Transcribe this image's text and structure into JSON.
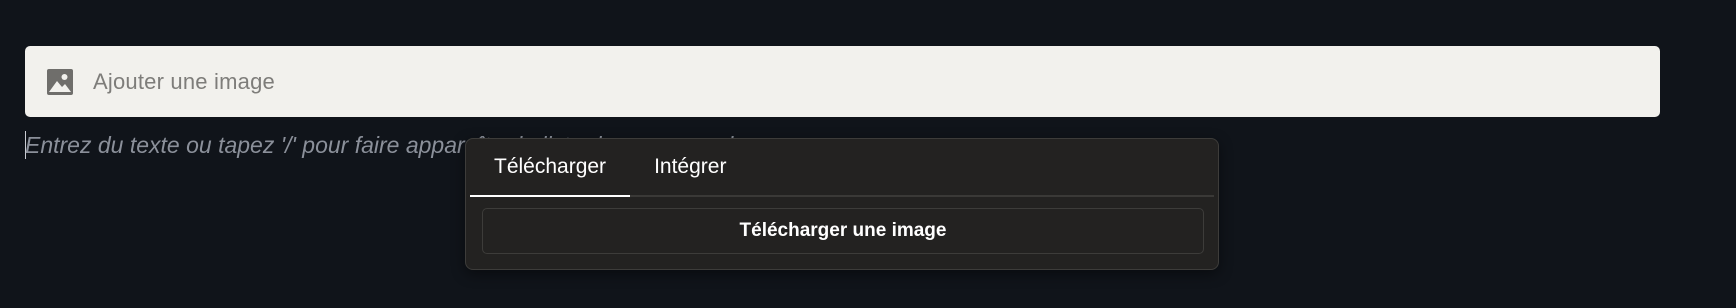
{
  "image_block": {
    "icon": "image-icon",
    "label": "Ajouter une image"
  },
  "editor": {
    "placeholder": "Entrez du texte ou tapez '/' pour faire apparaître la liste des commandes"
  },
  "popover": {
    "tabs": [
      {
        "label": "Télécharger",
        "active": true
      },
      {
        "label": "Intégrer",
        "active": false
      }
    ],
    "upload_button_label": "Télécharger une image"
  },
  "colors": {
    "background": "#10141a",
    "image_block_bg": "#f2f1ed",
    "popover_bg": "#232221",
    "text_light": "#ffffff",
    "placeholder": "#8b909a"
  }
}
